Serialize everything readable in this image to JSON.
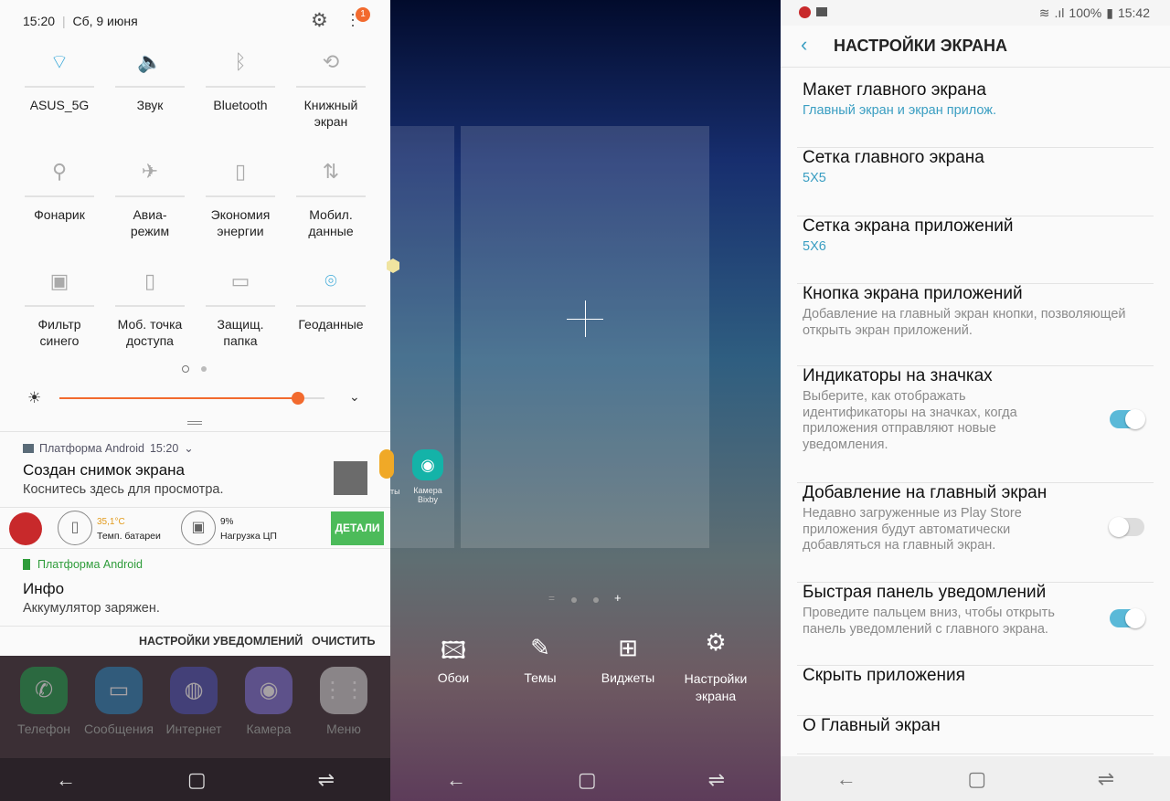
{
  "left": {
    "status": {
      "time": "15:20",
      "date": "Сб, 9 июня",
      "badge": "1"
    },
    "tiles": [
      {
        "label": "ASUS_5G",
        "icon": "wifi-icon",
        "active": true
      },
      {
        "label": "Звук",
        "icon": "sound-icon",
        "active": true
      },
      {
        "label": "Bluetooth",
        "icon": "bluetooth-icon",
        "active": false
      },
      {
        "label": "Книжный экран",
        "icon": "rotation-icon",
        "active": false
      },
      {
        "label": "Фонарик",
        "icon": "flashlight-icon",
        "active": false
      },
      {
        "label": "Авиа-режим",
        "icon": "airplane-icon",
        "active": false
      },
      {
        "label": "Экономия энергии",
        "icon": "battery-saver-icon",
        "active": false
      },
      {
        "label": "Мобил. данные",
        "icon": "mobile-data-icon",
        "active": false
      },
      {
        "label": "Фильтр синего",
        "icon": "blue-filter-icon",
        "active": false
      },
      {
        "label": "Моб. точка доступа",
        "icon": "hotspot-icon",
        "active": false
      },
      {
        "label": "Защищ. папка",
        "icon": "secure-folder-icon",
        "active": false
      },
      {
        "label": "Геоданные",
        "icon": "location-icon",
        "active": true
      }
    ],
    "brightness": 0.9,
    "notif1": {
      "app": "Платформа Android",
      "time": "15:20",
      "title": "Создан снимок экрана",
      "text": "Коснитесь здесь для просмотра."
    },
    "antutu": {
      "temp": "35,1°C",
      "temp_label": "Темп. батареи",
      "cpu": "9%",
      "cpu_label": "Нагрузка ЦП",
      "button": "ДЕТАЛИ"
    },
    "notif2": {
      "app": "Платформа Android",
      "title": "Инфо",
      "text": "Аккумулятор заряжен."
    },
    "actions": {
      "settings": "НАСТРОЙКИ УВЕДОМЛЕНИЙ",
      "clear": "ОЧИСТИТЬ"
    },
    "dock": [
      "Телефон",
      "Сообщения",
      "Интернет",
      "Камера",
      "Меню"
    ]
  },
  "middle": {
    "partial_label": "ты",
    "app": "Камера Bixby",
    "options": [
      "Обои",
      "Темы",
      "Виджеты",
      "Настройки экрана"
    ]
  },
  "right": {
    "status": {
      "battery": "100%",
      "time": "15:42"
    },
    "title": "НАСТРОЙКИ ЭКРАНА",
    "items": [
      {
        "title": "Макет главного экрана",
        "sub": "Главный экран и экран прилож."
      },
      {
        "title": "Сетка главного экрана",
        "sub": "5X5"
      },
      {
        "title": "Сетка экрана приложений",
        "sub": "5X6"
      },
      {
        "title": "Кнопка экрана приложений",
        "sub": "Добавление на главный экран кнопки, позволяющей открыть экран приложений."
      },
      {
        "title": "Индикаторы на значках",
        "sub": "Выберите, как отображать идентификаторы на значках, когда приложения отправляют новые уведомления.",
        "toggle": true
      },
      {
        "title": "Добавление на главный экран",
        "sub": "Недавно загруженные из Play Store приложения будут автоматически добавляться на главный экран.",
        "toggle": false
      },
      {
        "title": "Быстрая панель уведомлений",
        "sub": "Проведите пальцем вниз, чтобы открыть панель уведомлений с главного экрана.",
        "toggle": true
      },
      {
        "title": "Скрыть приложения"
      },
      {
        "title": "О Главный экран"
      }
    ]
  },
  "colors": {
    "accent": "#3a9ec2",
    "orange": "#f26a2e",
    "green": "#4cbb5a",
    "toggle_on": "#5ab9d8"
  }
}
